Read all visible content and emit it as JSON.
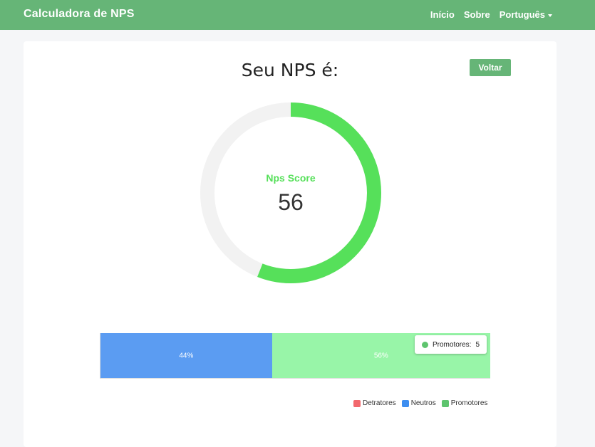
{
  "navbar": {
    "brand": "Calculadora de NPS",
    "links": [
      {
        "label": "Início"
      },
      {
        "label": "Sobre"
      },
      {
        "label": "Português"
      }
    ]
  },
  "main": {
    "title": "Seu NPS é:",
    "back_label": "Voltar"
  },
  "gauge": {
    "label": "Nps Score",
    "value": "56",
    "score": 56,
    "max": 100,
    "color": "#56e05a",
    "track_color": "#f2f2f2"
  },
  "chart_data": {
    "type": "bar",
    "orientation": "horizontal-stacked",
    "series": [
      {
        "name": "Detratores",
        "value": 0,
        "label": "",
        "color": "#f2686d"
      },
      {
        "name": "Neutros",
        "value": 44,
        "label": "44%",
        "color": "#5b9cf2"
      },
      {
        "name": "Promotores",
        "value": 56,
        "label": "56%",
        "color": "#98f5a8"
      }
    ],
    "legend_colors": {
      "Detratores": "#f2686d",
      "Neutros": "#3d8ef0",
      "Promotores": "#5ec46e"
    },
    "legend_position": "bottom-right",
    "tooltip": {
      "label": "Promotores:",
      "value": "5",
      "color": "#5ec46e"
    }
  }
}
